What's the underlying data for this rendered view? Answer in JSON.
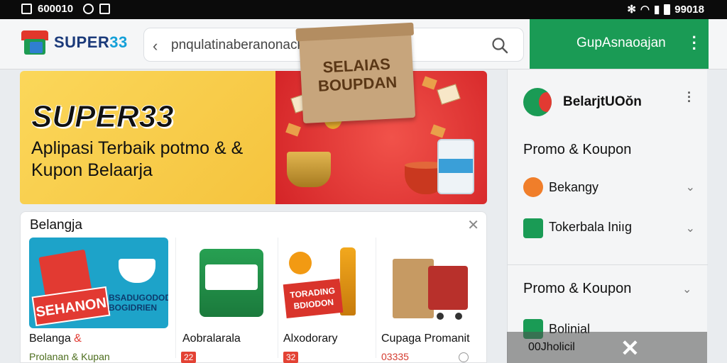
{
  "status_bar": {
    "left_text": "600010",
    "time": "99018"
  },
  "header": {
    "logo_text": "SUPER",
    "logo_number": "33",
    "search_placeholder": "pnqulatinaberanonackrion..",
    "action_button_label": "GupAsnaoajan"
  },
  "hero": {
    "title": "SUPER33",
    "subtitle": "Aplipasi Terbaik potmo & & Kupon Belaarja",
    "bag_text": "SELAIAS BOUPDAN"
  },
  "shop": {
    "title": "Belangja",
    "tiles": [
      {
        "image_text": "SEHANON",
        "promo_text": "BSADUGODOD BOGIDRIEN",
        "name": "Belanga",
        "meta": "Prolanan & Kupan"
      },
      {
        "name": "Aobralarala",
        "badge": "22"
      },
      {
        "image_text": "TORADING BDIODON",
        "name": "Alxodorary",
        "badge": "32"
      },
      {
        "name": "Cupaga Promanit",
        "meta": "03335"
      }
    ]
  },
  "panel": {
    "brand": "BelarjtUOŏn",
    "heading1": "Promo & Koupon",
    "items1": [
      {
        "label": "Bekangy",
        "icon": "tag-icon"
      },
      {
        "label": "Tokerbala Iniıg",
        "icon": "wallet-icon"
      }
    ],
    "heading2": "Promo & Koupon",
    "item2": {
      "label": "Bolinial",
      "icon": "cart-icon"
    }
  },
  "snackbar": {
    "text": "00Jholicil"
  },
  "colors": {
    "brand_green": "#1a9b55",
    "brand_red": "#e23a32",
    "hero_yellow": "#f5c33d"
  }
}
